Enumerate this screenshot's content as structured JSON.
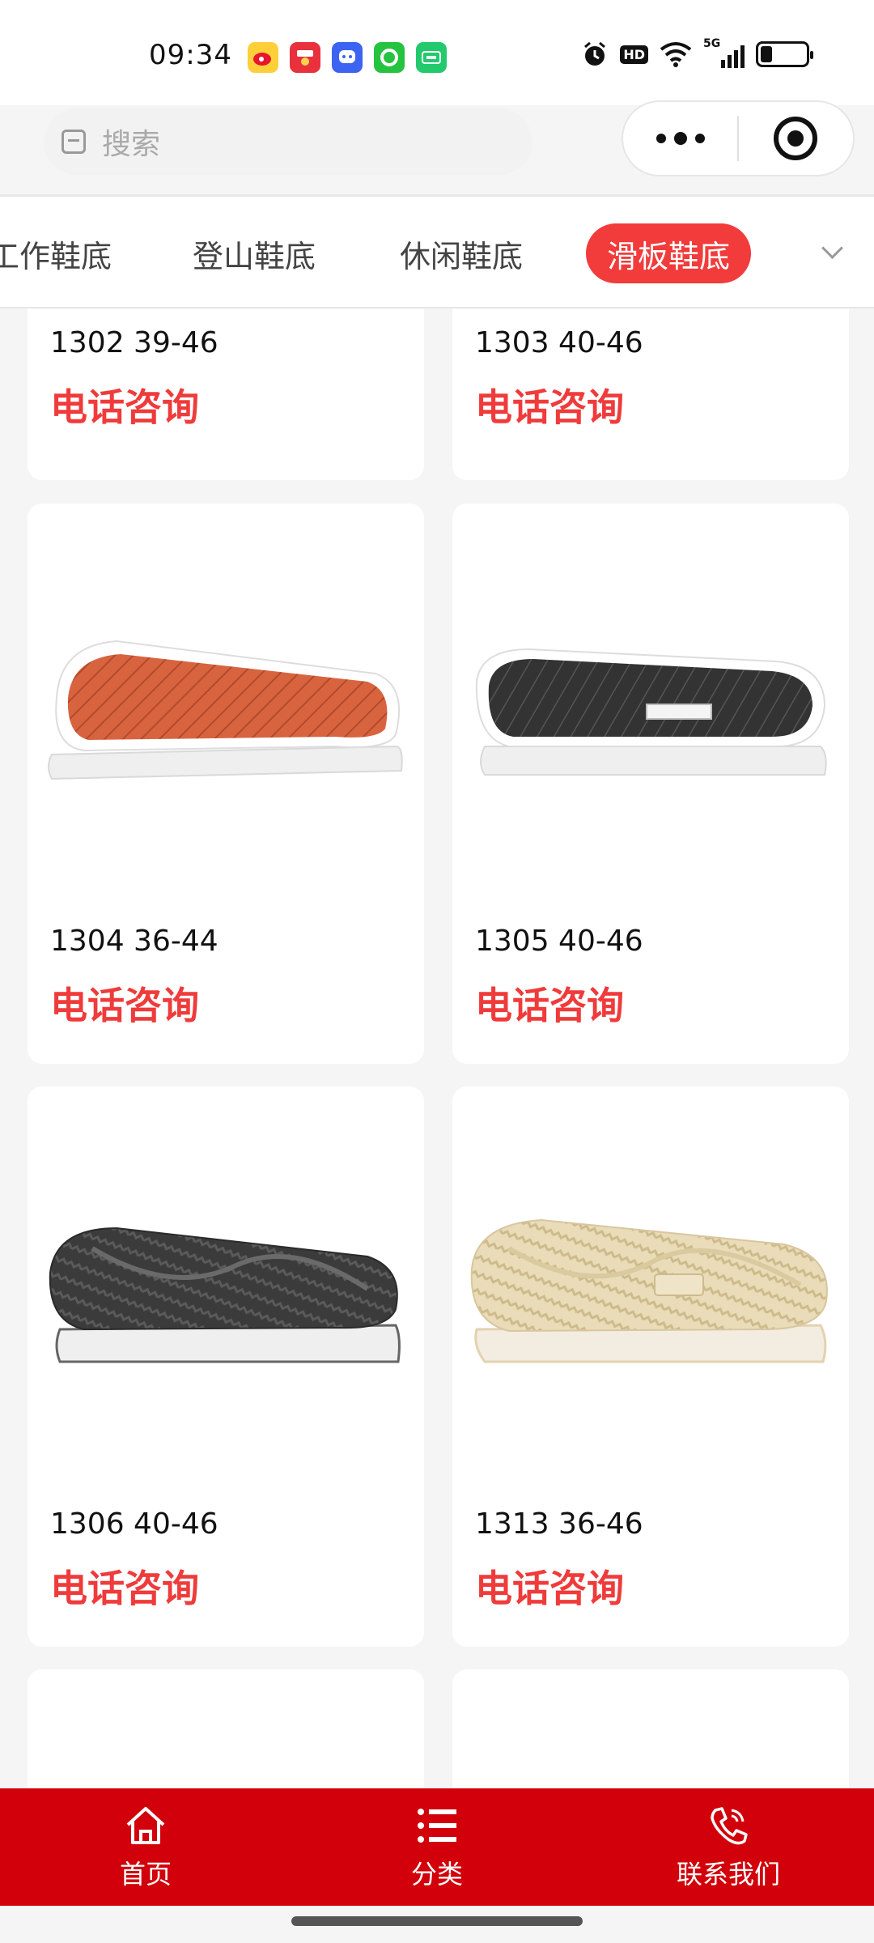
{
  "status_bar": {
    "time": "09:34",
    "app_icons": [
      {
        "name": "weibo-icon",
        "color": "#ffcf3a"
      },
      {
        "name": "taobao-special-icon",
        "color": "#e8313d"
      },
      {
        "name": "chat-app-icon",
        "color": "#3d63f2"
      },
      {
        "name": "music-app-icon",
        "color": "#25c340"
      },
      {
        "name": "iqiyi-icon",
        "color": "#22c96d"
      }
    ],
    "hd_label": "HD",
    "network_label": "5G",
    "battery_level": 0.25
  },
  "search": {
    "placeholder": "搜索"
  },
  "tabs": {
    "items": [
      {
        "label": "工作鞋底",
        "active": false
      },
      {
        "label": "登山鞋底",
        "active": false
      },
      {
        "label": "休闲鞋底",
        "active": false
      },
      {
        "label": "滑板鞋底",
        "active": true
      }
    ]
  },
  "products": [
    {
      "title": "1302 39-46",
      "price_label": "电话咨询",
      "sole_color": "#d8643f",
      "pattern": "diamond"
    },
    {
      "title": "1303 40-46",
      "price_label": "电话咨询",
      "sole_color": "#3a3a3a",
      "pattern": "diamond"
    },
    {
      "title": "1304 36-44",
      "price_label": "电话咨询",
      "sole_color": "#d8643f",
      "pattern": "diamond"
    },
    {
      "title": "1305 40-46",
      "price_label": "电话咨询",
      "sole_color": "#2f2f2f",
      "pattern": "wave"
    },
    {
      "title": "1306 40-46",
      "price_label": "电话咨询",
      "sole_color": "#3b3b3b",
      "pattern": "wave"
    },
    {
      "title": "1313 36-46",
      "price_label": "电话咨询",
      "sole_color": "#eadcb8",
      "pattern": "wave"
    }
  ],
  "bottom_nav": {
    "items": [
      {
        "label": "首页",
        "icon": "home-icon"
      },
      {
        "label": "分类",
        "icon": "list-icon"
      },
      {
        "label": "联系我们",
        "icon": "phone-icon"
      }
    ]
  },
  "colors": {
    "accent": "#f23b3b",
    "nav_background": "#d1000a",
    "price_text": "#ef3b3b"
  }
}
